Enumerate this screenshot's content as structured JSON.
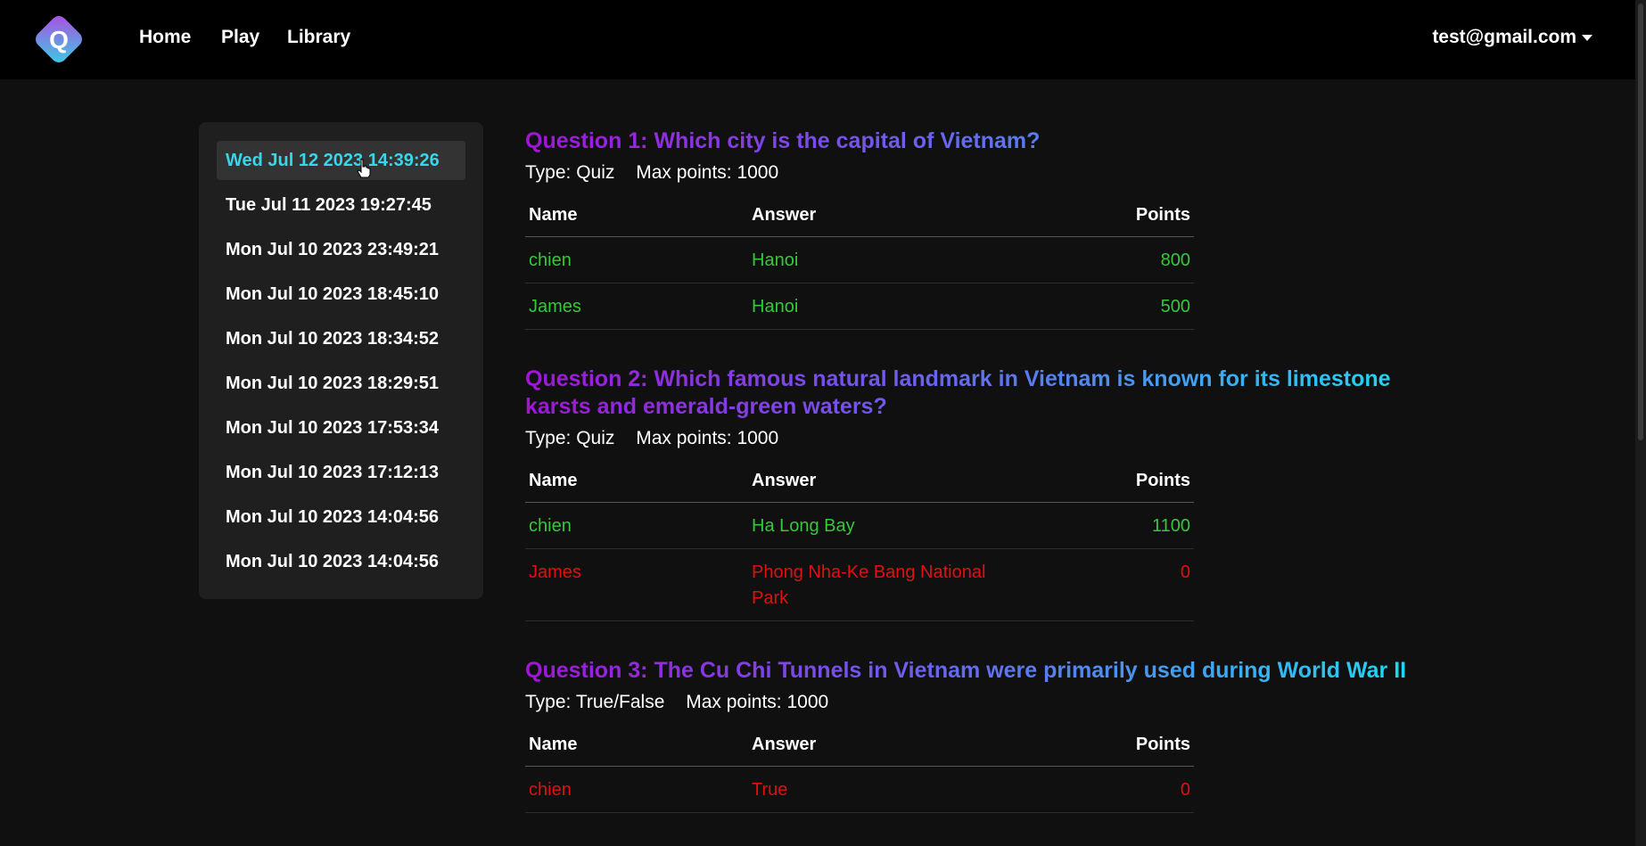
{
  "nav": {
    "links": [
      "Home",
      "Play",
      "Library"
    ],
    "user_email": "test@gmail.com",
    "logo_letter": "Q"
  },
  "sidebar": {
    "sessions": [
      "Wed Jul 12 2023 14:39:26",
      "Tue Jul 11 2023 19:27:45",
      "Mon Jul 10 2023 23:49:21",
      "Mon Jul 10 2023 18:45:10",
      "Mon Jul 10 2023 18:34:52",
      "Mon Jul 10 2023 18:29:51",
      "Mon Jul 10 2023 17:53:34",
      "Mon Jul 10 2023 17:12:13",
      "Mon Jul 10 2023 14:04:56",
      "Mon Jul 10 2023 14:04:56"
    ],
    "active_index": 0
  },
  "table_headers": {
    "name": "Name",
    "answer": "Answer",
    "points": "Points"
  },
  "questions": [
    {
      "title": "Question 1: Which city is the capital of Vietnam?",
      "type": "Type: Quiz",
      "max_points": "Max points: 1000",
      "rows": [
        {
          "name": "chien",
          "answer": "Hanoi",
          "points": "800",
          "correct": true
        },
        {
          "name": "James",
          "answer": "Hanoi",
          "points": "500",
          "correct": true
        }
      ]
    },
    {
      "title": "Question 2: Which famous natural landmark in Vietnam is known for its limestone karsts and emerald-green waters?",
      "type": "Type: Quiz",
      "max_points": "Max points: 1000",
      "rows": [
        {
          "name": "chien",
          "answer": "Ha Long Bay",
          "points": "1100",
          "correct": true
        },
        {
          "name": "James",
          "answer": "Phong Nha-Ke Bang National Park",
          "points": "0",
          "correct": false
        }
      ]
    },
    {
      "title": "Question 3: The Cu Chi Tunnels in Vietnam were primarily used during World War II",
      "type": "Type: True/False",
      "max_points": "Max points: 1000",
      "rows": [
        {
          "name": "chien",
          "answer": "True",
          "points": "0",
          "correct": false
        }
      ]
    }
  ],
  "colors": {
    "correct": "#36c73a",
    "wrong": "#e01010",
    "active_session": "#37d6e8",
    "gradient_start": "#a114d6",
    "gradient_end": "#1fd9f3"
  }
}
